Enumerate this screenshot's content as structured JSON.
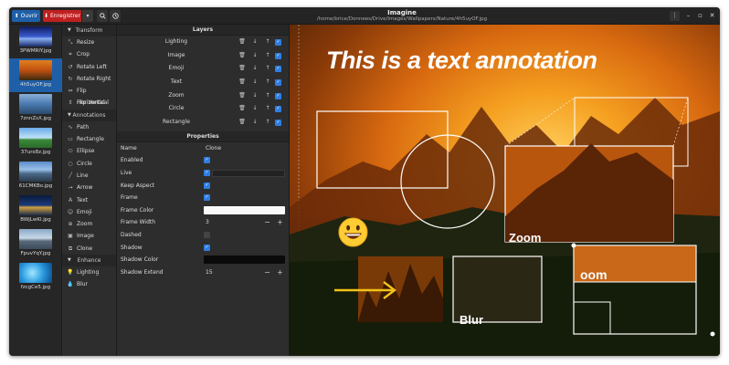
{
  "header": {
    "open_label": "Ouvrir",
    "save_label": "Enregistrer",
    "title": "Imagine",
    "path": "/home/brice/Donnees/Drive/Images/Wallpapers/Nature/4h5uyOF.jpg",
    "icons": [
      "upload-icon",
      "save-icon",
      "chevron-down-icon",
      "search-icon",
      "history-icon",
      "menu-icon",
      "minimize-icon",
      "maximize-icon",
      "close-icon"
    ]
  },
  "thumbnails": [
    {
      "label": "3PWMRlY.jpg",
      "selected": false,
      "color": "#2a4a9a"
    },
    {
      "label": "4h5uyOF.jpg",
      "selected": true,
      "color": "#d06a18"
    },
    {
      "label": "7znnZsX.jpg",
      "selected": false,
      "color": "#3a6aa8"
    },
    {
      "label": "37urx8z.jpg",
      "selected": false,
      "color": "#5a9ad8"
    },
    {
      "label": "61CMKBo.jpg",
      "selected": false,
      "color": "#4a7ab8"
    },
    {
      "label": "BWjLwKl.jpg",
      "selected": false,
      "color": "#1a3a6a"
    },
    {
      "label": "FpuvYqY.jpg",
      "selected": false,
      "color": "#6a8aa8"
    },
    {
      "label": "fzcgCe5.jpg",
      "selected": false,
      "color": "#2a8ad8"
    }
  ],
  "tools": {
    "sections": [
      {
        "label": "Transform",
        "items": [
          {
            "label": "Resize",
            "icon": "resize-icon"
          },
          {
            "label": "Crop",
            "icon": "crop-icon"
          },
          {
            "label": "Rotate Left",
            "icon": "rotate-left-icon"
          },
          {
            "label": "Rotate Right",
            "icon": "rotate-right-icon"
          },
          {
            "label": "Flip Horizontal",
            "icon": "flip-horizontal-icon"
          },
          {
            "label": "Flip Vertical",
            "icon": "flip-vertical-icon"
          }
        ]
      },
      {
        "label": "Annotations",
        "items": [
          {
            "label": "Path",
            "icon": "path-icon"
          },
          {
            "label": "Rectangle",
            "icon": "rectangle-icon"
          },
          {
            "label": "Ellipse",
            "icon": "ellipse-icon"
          },
          {
            "label": "Circle",
            "icon": "circle-icon"
          },
          {
            "label": "Line",
            "icon": "line-icon"
          },
          {
            "label": "Arrow",
            "icon": "arrow-icon"
          },
          {
            "label": "Text",
            "icon": "text-icon"
          },
          {
            "label": "Emoji",
            "icon": "emoji-icon"
          },
          {
            "label": "Zoom",
            "icon": "zoom-icon"
          },
          {
            "label": "Image",
            "icon": "image-icon"
          },
          {
            "label": "Clone",
            "icon": "clone-icon"
          }
        ]
      },
      {
        "label": "Enhance",
        "items": [
          {
            "label": "Lighting",
            "icon": "lighting-icon"
          },
          {
            "label": "Blur",
            "icon": "blur-icon"
          }
        ]
      }
    ]
  },
  "layers": {
    "title": "Layers",
    "items": [
      {
        "name": "Lighting",
        "visible": true
      },
      {
        "name": "Image",
        "visible": true
      },
      {
        "name": "Emoji",
        "visible": true
      },
      {
        "name": "Text",
        "visible": true
      },
      {
        "name": "Zoom",
        "visible": true
      },
      {
        "name": "Circle",
        "visible": true
      },
      {
        "name": "Rectangle",
        "visible": true
      }
    ]
  },
  "properties": {
    "title": "Properties",
    "name_label": "Name",
    "name_value": "Clone",
    "enabled_label": "Enabled",
    "live_label": "Live",
    "keep_aspect_label": "Keep Aspect",
    "frame_label": "Frame",
    "frame_color_label": "Frame Color",
    "frame_width_label": "Frame Width",
    "frame_width_value": "3",
    "dashed_label": "Dashed",
    "shadow_label": "Shadow",
    "shadow_color_label": "Shadow Color",
    "shadow_extend_label": "Shadow Extend",
    "shadow_extend_value": "15",
    "enabled": true,
    "live": true,
    "keep_aspect": true,
    "frame": true,
    "dashed": false,
    "shadow": true,
    "frame_color": "#ffffff",
    "shadow_color": "#000000"
  },
  "canvas": {
    "text_annotation": "This is a text annotation",
    "zoom_label": "Zoom",
    "zoom_label_clone": "oom",
    "blur_label": "Blur",
    "emoji": "😀"
  },
  "colors": {
    "accent": "#1e5fa8",
    "save": "#c02020",
    "checkbox": "#2f7de1"
  }
}
